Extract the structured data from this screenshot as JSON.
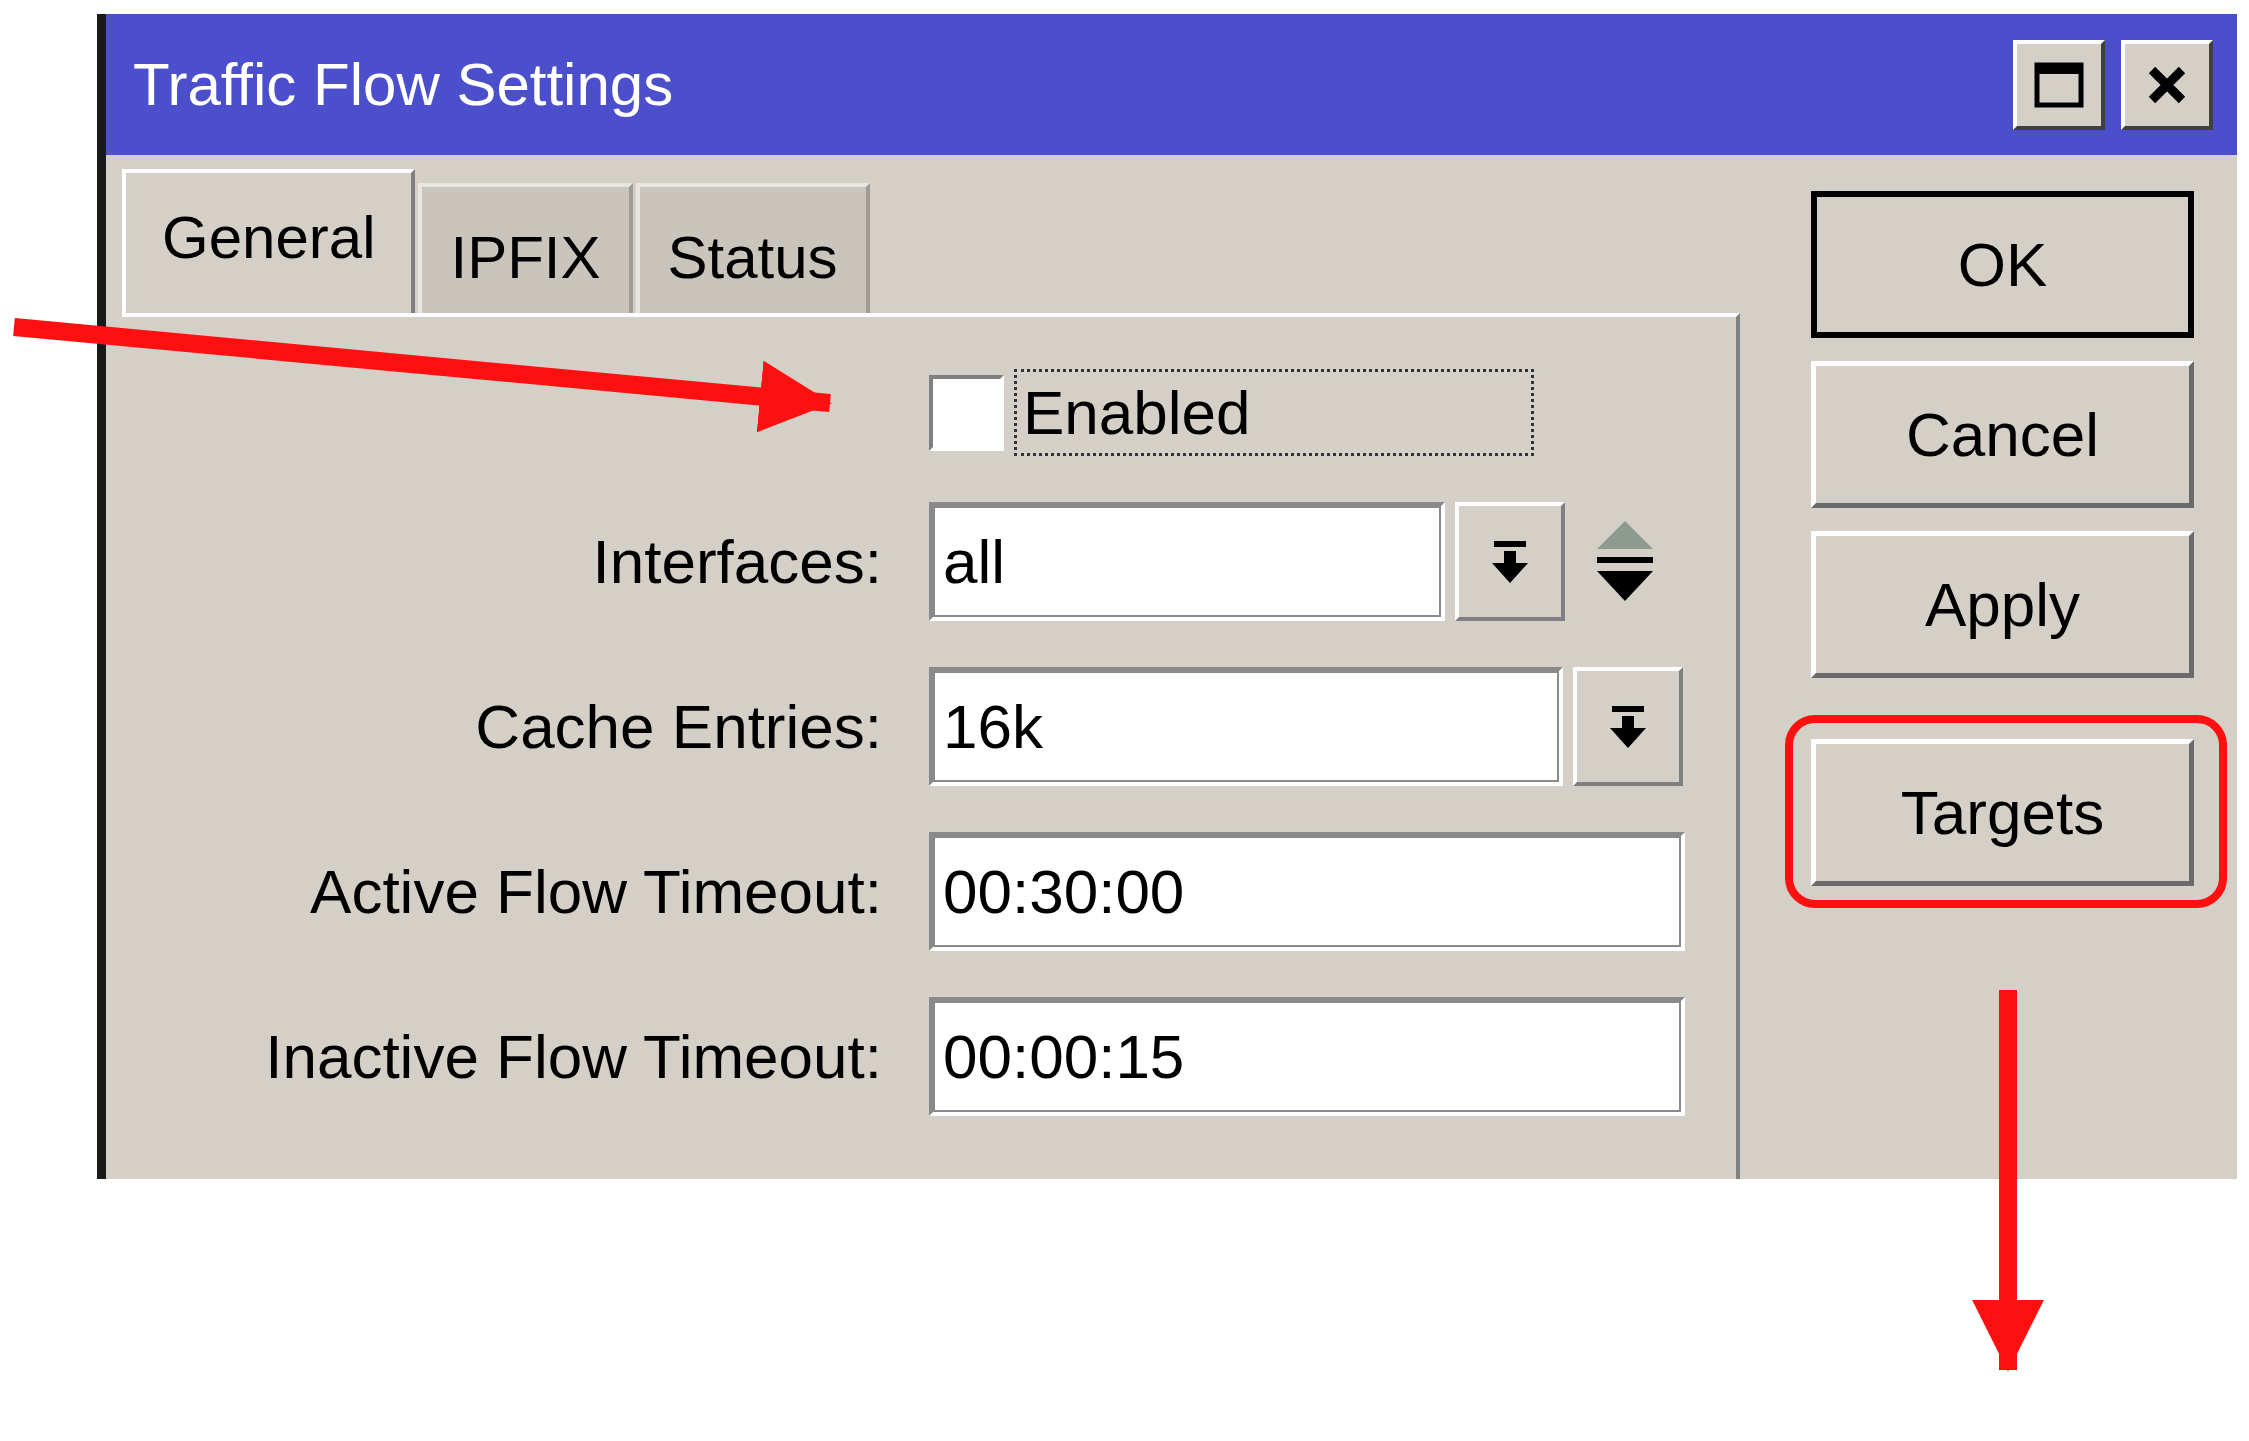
{
  "window": {
    "title": "Traffic Flow Settings"
  },
  "tabs": [
    {
      "label": "General",
      "selected": true
    },
    {
      "label": "IPFIX",
      "selected": false
    },
    {
      "label": "Status",
      "selected": false
    }
  ],
  "enabled": {
    "label": "Enabled",
    "checked": false
  },
  "fields": [
    {
      "label": "Interfaces:",
      "value": "all",
      "kind": "dropdown-updown"
    },
    {
      "label": "Cache Entries:",
      "value": "16k",
      "kind": "dropdown"
    },
    {
      "label": "Active Flow Timeout:",
      "value": "00:30:00",
      "kind": "text"
    },
    {
      "label": "Inactive Flow Timeout:",
      "value": "00:00:15",
      "kind": "text"
    }
  ],
  "buttons": [
    {
      "label": "OK",
      "default": true,
      "highlighted": false
    },
    {
      "label": "Cancel",
      "default": false,
      "highlighted": false
    },
    {
      "label": "Apply",
      "default": false,
      "highlighted": false
    },
    {
      "label": "Targets",
      "default": false,
      "highlighted": true
    }
  ]
}
